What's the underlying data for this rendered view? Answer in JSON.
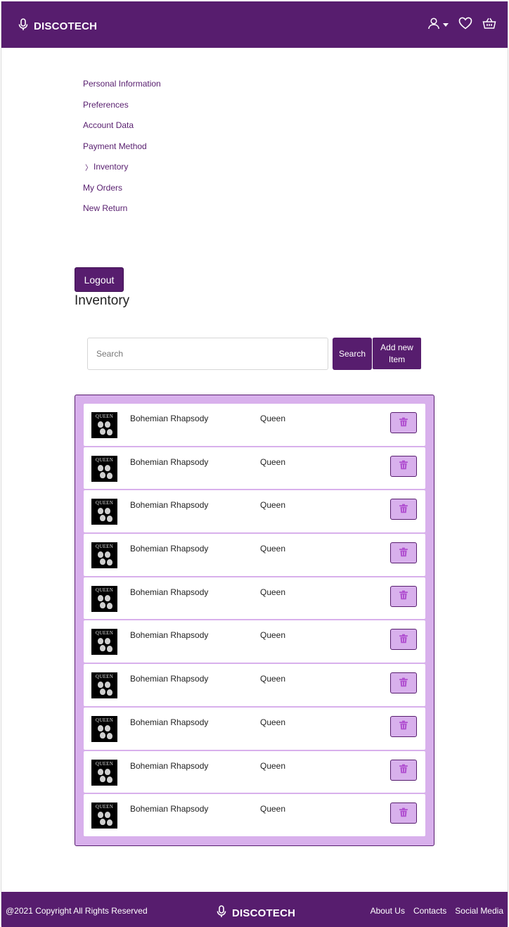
{
  "header": {
    "brand": "DISCOTECH",
    "icons": [
      "microphone-icon",
      "user-icon",
      "heart-icon",
      "basket-icon"
    ]
  },
  "menu": {
    "items": [
      {
        "label": "Personal Information"
      },
      {
        "label": "Preferences"
      },
      {
        "label": "Account Data"
      },
      {
        "label": "Payment Method"
      },
      {
        "label": "Inventory",
        "active": true
      },
      {
        "label": "My Orders"
      },
      {
        "label": "New Return"
      }
    ]
  },
  "logout_label": "Logout",
  "page_title": "Inventory",
  "search": {
    "placeholder": "Search",
    "button_label": "Search",
    "add_label": "Add new Item"
  },
  "inventory": {
    "rows": [
      {
        "title": "Bohemian Rhapsody",
        "artist": "Queen",
        "cover_text": "QUEEN"
      },
      {
        "title": "Bohemian Rhapsody",
        "artist": "Queen",
        "cover_text": "QUEEN"
      },
      {
        "title": "Bohemian Rhapsody",
        "artist": "Queen",
        "cover_text": "QUEEN"
      },
      {
        "title": "Bohemian Rhapsody",
        "artist": "Queen",
        "cover_text": "QUEEN"
      },
      {
        "title": "Bohemian Rhapsody",
        "artist": "Queen",
        "cover_text": "QUEEN"
      },
      {
        "title": "Bohemian Rhapsody",
        "artist": "Queen",
        "cover_text": "QUEEN"
      },
      {
        "title": "Bohemian Rhapsody",
        "artist": "Queen",
        "cover_text": "QUEEN"
      },
      {
        "title": "Bohemian Rhapsody",
        "artist": "Queen",
        "cover_text": "QUEEN"
      },
      {
        "title": "Bohemian Rhapsody",
        "artist": "Queen",
        "cover_text": "QUEEN"
      },
      {
        "title": "Bohemian Rhapsody",
        "artist": "Queen",
        "cover_text": "QUEEN"
      }
    ]
  },
  "footer": {
    "copyright": "@2021 Copyright All Rights Reserved",
    "brand": "DISCOTECH",
    "links": [
      {
        "label": "About Us"
      },
      {
        "label": "Contacts"
      },
      {
        "label": "Social Media"
      }
    ]
  },
  "colors": {
    "primary": "#571d6e",
    "list_background": "#d8b0ec",
    "trash_icon": "#b04fd0"
  }
}
